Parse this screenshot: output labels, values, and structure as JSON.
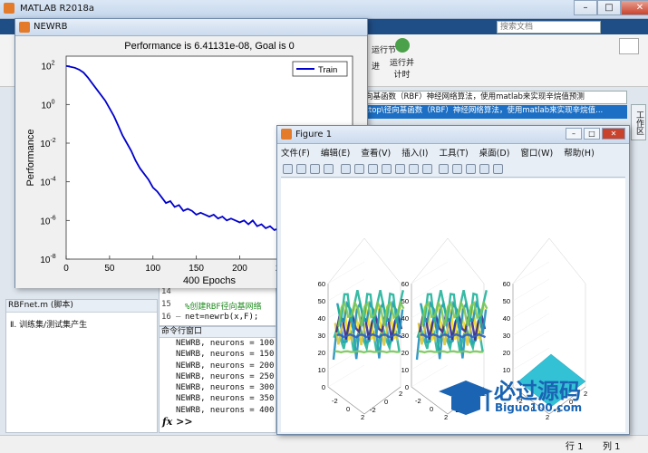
{
  "app": {
    "title": "MATLAB R2018a",
    "search_placeholder": "搜索文档",
    "toolstrip": {
      "section_label": "运行节",
      "run_advance": "运行并\n计时",
      "advance": "进"
    },
    "address": {
      "row1": "向基函数（RBF）神经网络算法，使用matlab来实现辛烷值预测",
      "row2": "ktop\\径向基函数（RBF）神经网络算法，使用matlab来实现辛烷值..."
    },
    "side_tab": "工作区",
    "left_panel": {
      "header": "RBFnet.m (脚本)",
      "item": "Ⅱ. 训练集/测试集产生"
    },
    "editor": {
      "lines": [
        {
          "num": "14",
          "code": ""
        },
        {
          "num": "15",
          "code": "%创建RBF径向基网络"
        },
        {
          "num": "16",
          "code": "net=newrb(x,F);"
        }
      ]
    },
    "command_window": {
      "header": "命令行窗口",
      "lines": [
        "NEWRB, neurons = 100, MSE",
        "NEWRB, neurons = 150, MSE",
        "NEWRB, neurons = 200, MSE",
        "NEWRB, neurons = 250, MSE",
        "NEWRB, neurons = 300, MSE",
        "NEWRB, neurons = 350, MSE",
        "NEWRB, neurons = 400, MSE"
      ],
      "prompt": "fx >>"
    },
    "status": {
      "row": "行 1",
      "col": "列 1"
    }
  },
  "newrb_window": {
    "title": "NEWRB",
    "chart_data": {
      "type": "line",
      "title": "Performance is 6.41131e-08, Goal is 0",
      "xlabel": "400 Epochs",
      "ylabel": "Performance",
      "xlim": [
        0,
        330
      ],
      "ylim_log10": [
        -8,
        2.5
      ],
      "x_ticks": [
        0,
        50,
        100,
        150,
        200,
        250,
        300
      ],
      "y_ticks": [
        "10^2",
        "10^0",
        "10^-2",
        "10^-4",
        "10^-6",
        "10^-8"
      ],
      "y_scale": "log",
      "legend": {
        "placement": "top-right",
        "entries": [
          "Train"
        ]
      },
      "series": [
        {
          "name": "Train",
          "color": "#0000cc",
          "x": [
            0,
            5,
            10,
            15,
            20,
            25,
            30,
            35,
            40,
            45,
            50,
            55,
            60,
            65,
            70,
            75,
            80,
            85,
            90,
            95,
            100,
            105,
            110,
            115,
            120,
            125,
            130,
            135,
            140,
            145,
            150,
            155,
            160,
            165,
            170,
            175,
            180,
            185,
            190,
            195,
            200,
            205,
            210,
            215,
            220,
            225,
            230,
            235,
            240,
            245,
            250,
            255,
            260,
            265,
            270,
            275,
            280,
            285,
            290,
            295,
            300,
            305,
            310,
            315,
            320,
            325,
            330
          ],
          "log10_y": [
            2.0,
            1.95,
            1.9,
            1.8,
            1.65,
            1.4,
            1.1,
            0.8,
            0.5,
            0.2,
            -0.2,
            -0.6,
            -1.1,
            -1.6,
            -2.0,
            -2.4,
            -2.9,
            -3.3,
            -3.6,
            -3.9,
            -4.3,
            -4.5,
            -4.8,
            -5.1,
            -5.0,
            -5.3,
            -5.2,
            -5.5,
            -5.4,
            -5.5,
            -5.7,
            -5.6,
            -5.7,
            -5.8,
            -5.7,
            -5.9,
            -5.8,
            -6.0,
            -5.9,
            -6.0,
            -6.1,
            -6.0,
            -6.2,
            -6.0,
            -6.3,
            -6.2,
            -6.4,
            -6.3,
            -6.5,
            -6.4,
            -6.6,
            -6.5,
            -6.8,
            -6.6,
            -6.9,
            -6.7,
            -6.9,
            -7.0,
            -6.9,
            -7.2,
            -7.1,
            -7.3,
            -7.2,
            -7.1,
            -7.1,
            -7.15,
            -7.2
          ]
        }
      ]
    }
  },
  "figure_window": {
    "title": "Figure 1",
    "menu": [
      "文件(F)",
      "编辑(E)",
      "查看(V)",
      "插入(I)",
      "工具(T)",
      "桌面(D)",
      "窗口(W)",
      "帮助(H)"
    ],
    "z_ticks": [
      "60",
      "50",
      "40",
      "30",
      "20",
      "10",
      "0"
    ],
    "x_ticks": [
      "-2",
      "0",
      "2"
    ],
    "y_ticks": [
      "-2",
      "0",
      "2"
    ]
  },
  "watermark": {
    "main": "必过源码",
    "sub": "Biguo100.com"
  }
}
